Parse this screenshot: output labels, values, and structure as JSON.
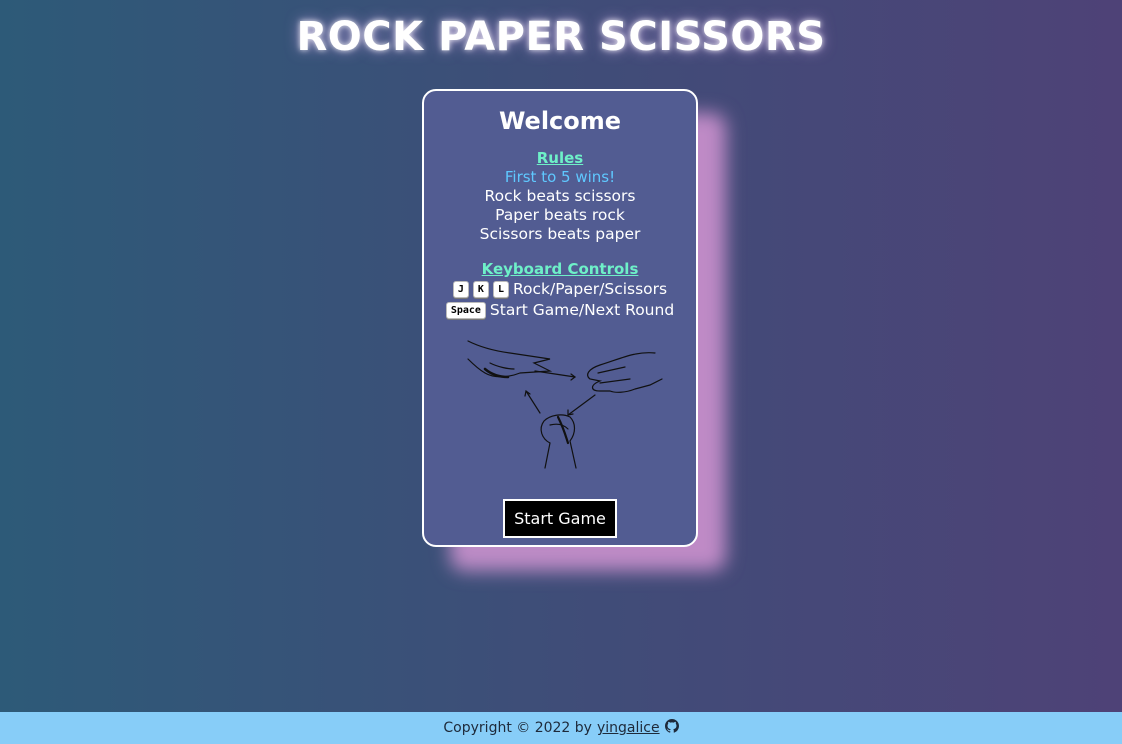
{
  "page": {
    "title": "ROCK PAPER SCISSORS"
  },
  "card": {
    "heading": "Welcome",
    "rules": {
      "title": "Rules",
      "highlight": "First to 5 wins!",
      "lines": [
        "Rock beats scissors",
        "Paper beats rock",
        "Scissors beats paper"
      ]
    },
    "controls": {
      "title": "Keyboard Controls",
      "keys": [
        "J",
        "K",
        "L"
      ],
      "keys_desc": "Rock/Paper/Scissors",
      "space_key": "Space",
      "space_desc": "Start Game/Next Round"
    },
    "start_button": "Start Game"
  },
  "footer": {
    "text": "Copyright © 2022 by",
    "author": "yingalice",
    "icon": "github-icon"
  },
  "colors": {
    "accent_green": "#6ef0c8",
    "accent_blue": "#5fc8ff",
    "card_bg": "#525c92",
    "footer_bg": "#87cdf8"
  }
}
